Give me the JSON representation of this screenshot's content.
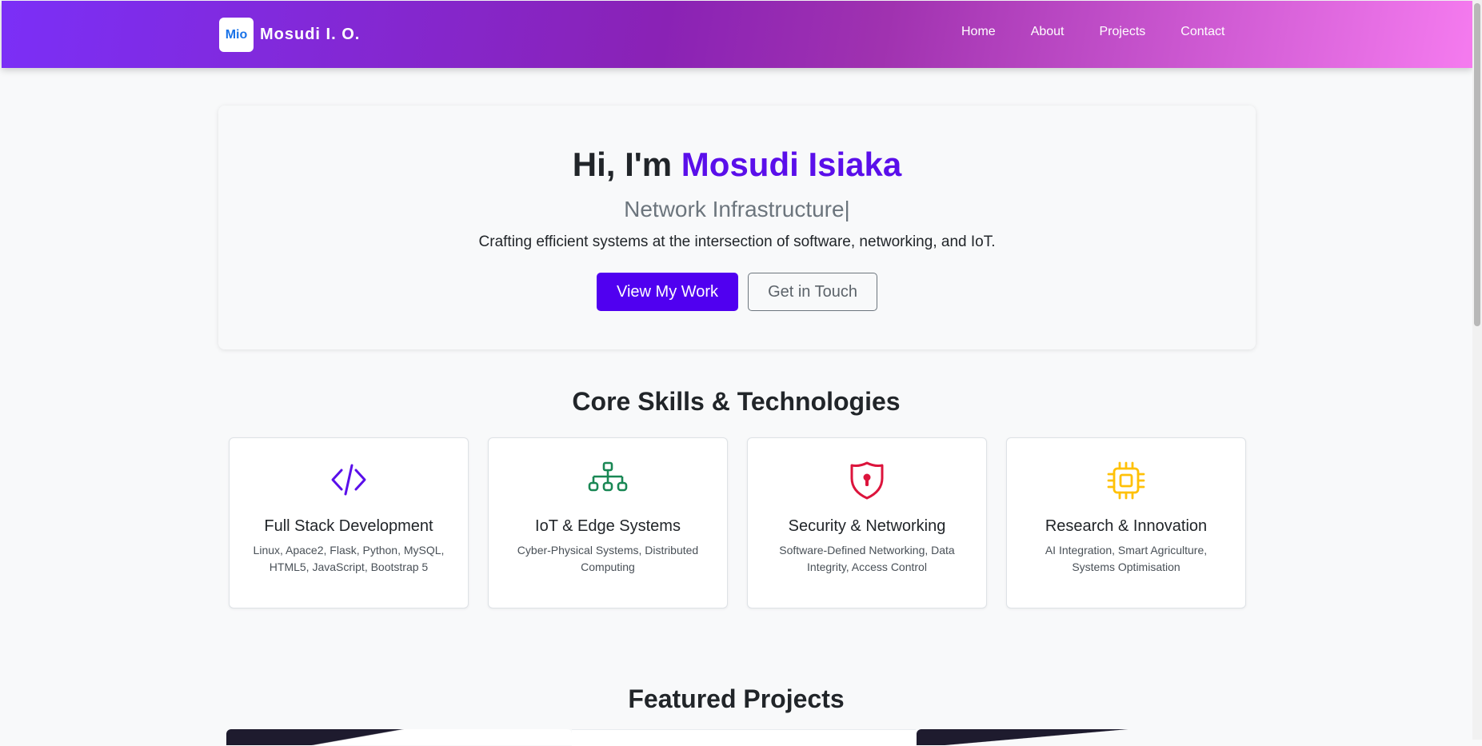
{
  "nav": {
    "logo_text": "Mio",
    "brand": "Mosudi I. O.",
    "links": [
      "Home",
      "About",
      "Projects",
      "Contact"
    ]
  },
  "hero": {
    "greeting": "Hi, I'm",
    "name": "Mosudi Isiaka",
    "role": "Network Infrastructure|",
    "tagline": "Crafting efficient systems at the intersection of software, networking, and IoT.",
    "primary_button": "View My Work",
    "secondary_button": "Get in Touch"
  },
  "skills": {
    "heading": "Core Skills & Technologies",
    "cards": [
      {
        "icon": "code-icon",
        "color": "#5a0fea",
        "title": "Full Stack Development",
        "desc": "Linux, Apace2, Flask, Python, MySQL, HTML5, JavaScript, Bootstrap 5"
      },
      {
        "icon": "network-icon",
        "color": "#198754",
        "title": "IoT & Edge Systems",
        "desc": "Cyber-Physical Systems, Distributed Computing"
      },
      {
        "icon": "shield-lock-icon",
        "color": "#dc143c",
        "title": "Security & Networking",
        "desc": "Software-Defined Networking, Data Integrity, Access Control"
      },
      {
        "icon": "cpu-chip-icon",
        "color": "#ffc107",
        "title": "Research & Innovation",
        "desc": "AI Integration, Smart Agriculture, Systems Optimisation"
      }
    ]
  },
  "projects": {
    "heading": "Featured Projects"
  },
  "colors": {
    "accent": "#5a0fea",
    "primary_button": "#5000f0",
    "nav_gradient_start": "#7b2ff7",
    "nav_gradient_end": "#f57bef"
  }
}
